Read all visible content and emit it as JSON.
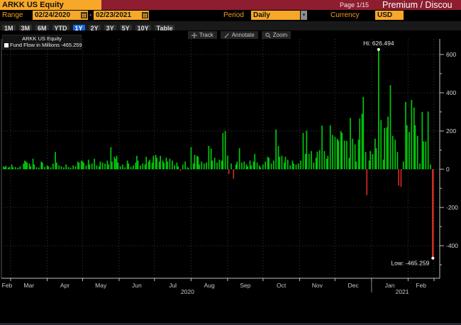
{
  "window": {
    "security": "ARKK US Equity",
    "page": "Page 1/15",
    "view_title": "Premium / Discou"
  },
  "controls": {
    "range_label": "Range",
    "range_start": "02/24/2020",
    "range_separator": "-",
    "range_end": "02/23/2021",
    "period_label": "Period",
    "period_value": "Daily",
    "dropdown_arrow": "▾",
    "currency_label": "Currency",
    "currency_value": "USD"
  },
  "range_tabs": {
    "items": [
      "1M",
      "3M",
      "6M",
      "YTD",
      "1Y",
      "2Y",
      "3Y",
      "5Y",
      "10Y",
      "Table"
    ],
    "selected": "1Y"
  },
  "chart_toolbar": {
    "track": "Track",
    "annotate": "Annotate",
    "zoom": "Zoom"
  },
  "legend": {
    "title": "ARKK US Equity",
    "series_label": "Fund Flow in Millions",
    "series_value": "-465.259"
  },
  "annotations": {
    "high_label": "Hi: 626.494",
    "low_label": "Low: -465.259"
  },
  "colors": {
    "up": "#00c60a",
    "down": "#cf2a1e",
    "grid": "#3a3a3a",
    "axis": "#c0c0c0",
    "tick_text": "#d6d6d6",
    "annotation_text": "#e8e8e8"
  },
  "chart_data": {
    "type": "bar",
    "title": "ARKK US Equity Fund Flow in Millions",
    "start_date": "02/24/2020",
    "end_date": "02/23/2021",
    "unit": "Millions USD",
    "high": 626.494,
    "low": -465.259,
    "ylim": [
      -570,
      680
    ],
    "yticks_major": [
      600,
      400,
      200,
      0,
      -200,
      -400
    ],
    "yticks_minor": [
      500,
      300,
      100,
      -100,
      -300,
      -500
    ],
    "month_labels": [
      "Feb",
      "Mar",
      "Apr",
      "May",
      "Jun",
      "Jul",
      "Aug",
      "Sep",
      "Oct",
      "Nov",
      "Dec",
      "Jan",
      "Feb"
    ],
    "month_boundary_days": [
      6,
      37,
      67,
      98,
      128,
      159,
      190,
      220,
      251,
      281,
      312,
      343
    ],
    "total_days": 365,
    "year_labels": [
      {
        "label": "2020",
        "center_day": 156
      },
      {
        "label": "2021",
        "center_day": 338
      }
    ],
    "year_divider_day": 312,
    "bars": [
      [
        0,
        15
      ],
      [
        1,
        10
      ],
      [
        2,
        18
      ],
      [
        4,
        8
      ],
      [
        5,
        12
      ],
      [
        7,
        25
      ],
      [
        8,
        10
      ],
      [
        10,
        12
      ],
      [
        12,
        8
      ],
      [
        14,
        15
      ],
      [
        17,
        30
      ],
      [
        18,
        45
      ],
      [
        19,
        40
      ],
      [
        20,
        35
      ],
      [
        22,
        30
      ],
      [
        23,
        15
      ],
      [
        25,
        55
      ],
      [
        26,
        25
      ],
      [
        28,
        10
      ],
      [
        30,
        8
      ],
      [
        32,
        40
      ],
      [
        33,
        35
      ],
      [
        35,
        12
      ],
      [
        37,
        20
      ],
      [
        38,
        15
      ],
      [
        40,
        10
      ],
      [
        42,
        30
      ],
      [
        44,
        90
      ],
      [
        45,
        35
      ],
      [
        47,
        20
      ],
      [
        49,
        15
      ],
      [
        51,
        10
      ],
      [
        53,
        25
      ],
      [
        55,
        12
      ],
      [
        57,
        8
      ],
      [
        59,
        20
      ],
      [
        61,
        15
      ],
      [
        63,
        40
      ],
      [
        64,
        35
      ],
      [
        66,
        45
      ],
      [
        67,
        40
      ],
      [
        68,
        35
      ],
      [
        70,
        20
      ],
      [
        72,
        50
      ],
      [
        73,
        25
      ],
      [
        75,
        30
      ],
      [
        77,
        55
      ],
      [
        79,
        20
      ],
      [
        81,
        15
      ],
      [
        82,
        40
      ],
      [
        84,
        35
      ],
      [
        86,
        30
      ],
      [
        88,
        45
      ],
      [
        89,
        25
      ],
      [
        91,
        115
      ],
      [
        92,
        40
      ],
      [
        94,
        65
      ],
      [
        95,
        55
      ],
      [
        96,
        70
      ],
      [
        97,
        35
      ],
      [
        99,
        15
      ],
      [
        101,
        25
      ],
      [
        103,
        10
      ],
      [
        105,
        45
      ],
      [
        106,
        30
      ],
      [
        108,
        12
      ],
      [
        110,
        20
      ],
      [
        112,
        35
      ],
      [
        113,
        70
      ],
      [
        114,
        45
      ],
      [
        116,
        20
      ],
      [
        118,
        30
      ],
      [
        120,
        25
      ],
      [
        121,
        65
      ],
      [
        123,
        40
      ],
      [
        124,
        50
      ],
      [
        126,
        35
      ],
      [
        127,
        70
      ],
      [
        129,
        75
      ],
      [
        130,
        60
      ],
      [
        132,
        40
      ],
      [
        133,
        70
      ],
      [
        135,
        45
      ],
      [
        136,
        35
      ],
      [
        138,
        60
      ],
      [
        139,
        40
      ],
      [
        141,
        55
      ],
      [
        143,
        45
      ],
      [
        145,
        20
      ],
      [
        147,
        35
      ],
      [
        148,
        15
      ],
      [
        150,
        -8
      ],
      [
        152,
        25
      ],
      [
        154,
        40
      ],
      [
        156,
        10
      ],
      [
        157,
        5
      ],
      [
        159,
        115
      ],
      [
        161,
        30
      ],
      [
        162,
        75
      ],
      [
        164,
        70
      ],
      [
        165,
        65
      ],
      [
        166,
        25
      ],
      [
        168,
        40
      ],
      [
        170,
        30
      ],
      [
        172,
        35
      ],
      [
        174,
        122
      ],
      [
        176,
        108
      ],
      [
        177,
        45
      ],
      [
        179,
        60
      ],
      [
        181,
        35
      ],
      [
        183,
        50
      ],
      [
        185,
        45
      ],
      [
        186,
        190
      ],
      [
        188,
        200
      ],
      [
        190,
        70
      ],
      [
        191,
        -25
      ],
      [
        193,
        30
      ],
      [
        195,
        -50
      ],
      [
        197,
        25
      ],
      [
        198,
        40
      ],
      [
        200,
        110
      ],
      [
        202,
        35
      ],
      [
        204,
        40
      ],
      [
        206,
        25
      ],
      [
        207,
        15
      ],
      [
        209,
        45
      ],
      [
        210,
        20
      ],
      [
        212,
        40
      ],
      [
        213,
        80
      ],
      [
        215,
        35
      ],
      [
        217,
        20
      ],
      [
        218,
        10
      ],
      [
        220,
        25
      ],
      [
        222,
        40
      ],
      [
        224,
        65
      ],
      [
        225,
        60
      ],
      [
        227,
        30
      ],
      [
        229,
        45
      ],
      [
        231,
        208
      ],
      [
        233,
        122
      ],
      [
        234,
        65
      ],
      [
        236,
        70
      ],
      [
        238,
        35
      ],
      [
        239,
        65
      ],
      [
        241,
        50
      ],
      [
        243,
        20
      ],
      [
        245,
        45
      ],
      [
        246,
        30
      ],
      [
        248,
        25
      ],
      [
        250,
        30
      ],
      [
        252,
        45
      ],
      [
        254,
        190
      ],
      [
        256,
        80
      ],
      [
        257,
        202
      ],
      [
        259,
        80
      ],
      [
        261,
        95
      ],
      [
        263,
        35
      ],
      [
        265,
        60
      ],
      [
        266,
        92
      ],
      [
        268,
        100
      ],
      [
        270,
        228
      ],
      [
        272,
        95
      ],
      [
        274,
        55
      ],
      [
        275,
        70
      ],
      [
        277,
        230
      ],
      [
        279,
        180
      ],
      [
        281,
        170
      ],
      [
        283,
        160
      ],
      [
        284,
        150
      ],
      [
        286,
        200
      ],
      [
        287,
        190
      ],
      [
        289,
        150
      ],
      [
        291,
        148
      ],
      [
        293,
        60
      ],
      [
        294,
        268
      ],
      [
        296,
        160
      ],
      [
        298,
        130
      ],
      [
        299,
        40
      ],
      [
        301,
        155
      ],
      [
        302,
        265
      ],
      [
        304,
        290
      ],
      [
        305,
        378
      ],
      [
        307,
        90
      ],
      [
        308,
        -135
      ],
      [
        310,
        45
      ],
      [
        311,
        95
      ],
      [
        313,
        80
      ],
      [
        315,
        160
      ],
      [
        316,
        110
      ],
      [
        318,
        626.494
      ],
      [
        320,
        257
      ],
      [
        322,
        50
      ],
      [
        323,
        215
      ],
      [
        325,
        220
      ],
      [
        326,
        275
      ],
      [
        328,
        440
      ],
      [
        330,
        175
      ],
      [
        332,
        155
      ],
      [
        334,
        90
      ],
      [
        335,
        -85
      ],
      [
        337,
        -92
      ],
      [
        339,
        40
      ],
      [
        341,
        352
      ],
      [
        342,
        230
      ],
      [
        344,
        195
      ],
      [
        346,
        363
      ],
      [
        348,
        323
      ],
      [
        349,
        230
      ],
      [
        351,
        175
      ],
      [
        353,
        30
      ],
      [
        355,
        300
      ],
      [
        356,
        145
      ],
      [
        358,
        145
      ],
      [
        360,
        302
      ],
      [
        362,
        25
      ],
      [
        364,
        -465.259
      ]
    ]
  }
}
